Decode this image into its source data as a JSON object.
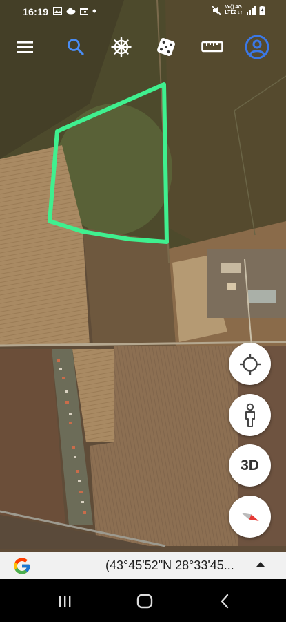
{
  "status_bar": {
    "time": "16:19",
    "network_line1": "Vo)) 4G",
    "network_line2": "LTE2 ↓↑",
    "notification_icons": [
      "gallery-icon",
      "cloud-icon",
      "calendar-icon",
      "dot-icon"
    ],
    "system_icons": [
      "mute-icon",
      "network-text",
      "signal-icon",
      "battery-icon"
    ]
  },
  "toolbar": {
    "items": [
      "menu-icon",
      "search-icon",
      "voyager-wheel-icon",
      "feeling-lucky-dice-icon",
      "measure-ruler-icon",
      "account-icon"
    ],
    "accent_color": "#3b78e7"
  },
  "map": {
    "type": "satellite",
    "drawn_polygon_color": "#3ff08f"
  },
  "floating_buttons": {
    "my_location": "my-location-icon",
    "street_view": "pegman-icon",
    "three_d_label": "3D",
    "compass": "compass-icon"
  },
  "coord_bar": {
    "logo": "google-g-icon",
    "coordinates": "(43°45'52\"N 28°33'45..."
  },
  "nav_bar": {
    "items": [
      "recent-apps-icon",
      "home-icon",
      "back-icon"
    ]
  }
}
